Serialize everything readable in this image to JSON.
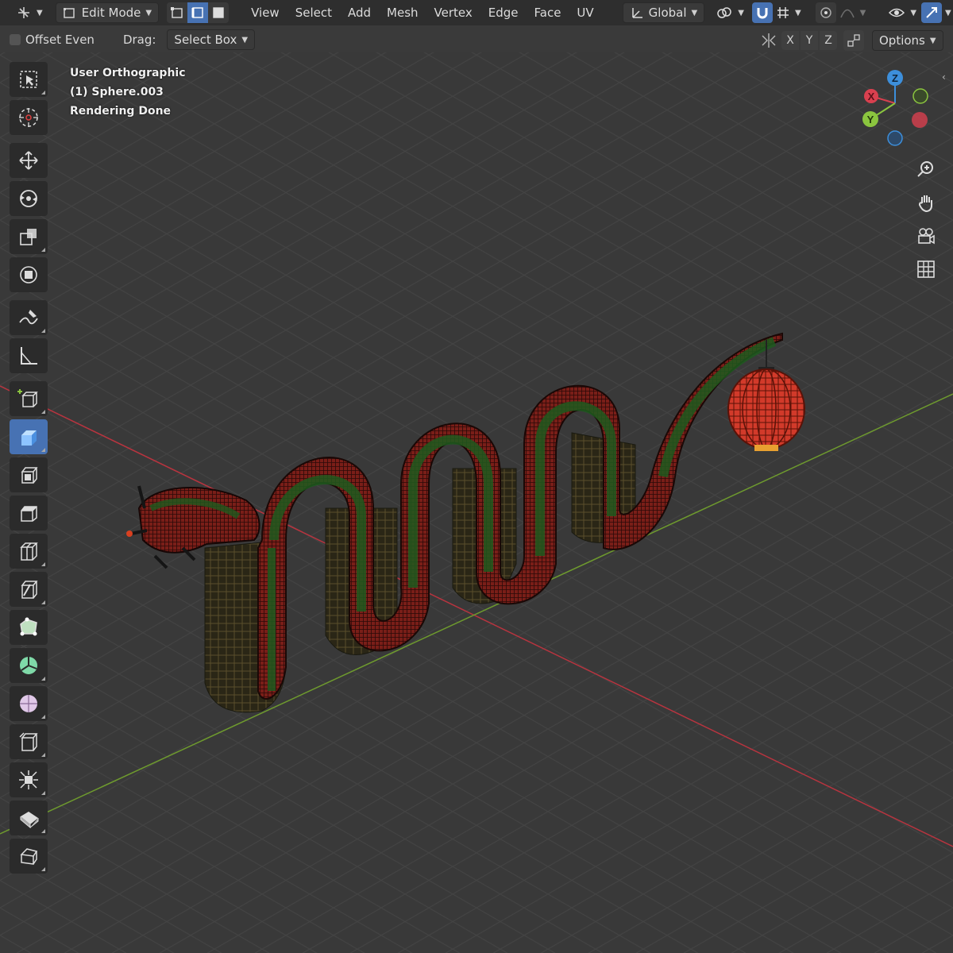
{
  "header": {
    "mode_label": "Edit Mode",
    "menus": [
      "View",
      "Select",
      "Add",
      "Mesh",
      "Vertex",
      "Edge",
      "Face",
      "UV"
    ],
    "transform_orientation": "Global"
  },
  "subbar": {
    "offset_even_label": "Offset Even",
    "drag_label": "Drag:",
    "drag_value": "Select Box",
    "axis_x": "X",
    "axis_y": "Y",
    "axis_z": "Z",
    "options_label": "Options"
  },
  "overlay": {
    "view_name": "User Orthographic",
    "object_name": "(1) Sphere.003",
    "status": "Rendering Done"
  },
  "gizmo": {
    "x_label": "X",
    "y_label": "Y",
    "z_label": "Z"
  },
  "colors": {
    "header_bg": "#2e2e2e",
    "viewport_bg": "#3a3a3a",
    "accent_active": "#4772b3",
    "x_axis": "#c03040",
    "y_axis": "#6a9a2a",
    "gizmo_x": "#d9404f",
    "gizmo_y": "#8bc53f",
    "gizmo_z": "#3d8fdb"
  },
  "toolbar_icons": [
    "select-box-icon",
    "cursor-icon",
    "move-icon",
    "rotate-icon",
    "scale-icon",
    "transform-icon",
    "annotate-icon",
    "measure-icon",
    "add-cube-icon",
    "extrude-region-icon",
    "inset-faces-icon",
    "bevel-icon",
    "loop-cut-icon",
    "knife-icon",
    "poly-build-icon",
    "spin-icon",
    "smooth-icon",
    "edge-slide-icon",
    "shrink-fatten-icon",
    "shear-icon",
    "rip-region-icon"
  ]
}
